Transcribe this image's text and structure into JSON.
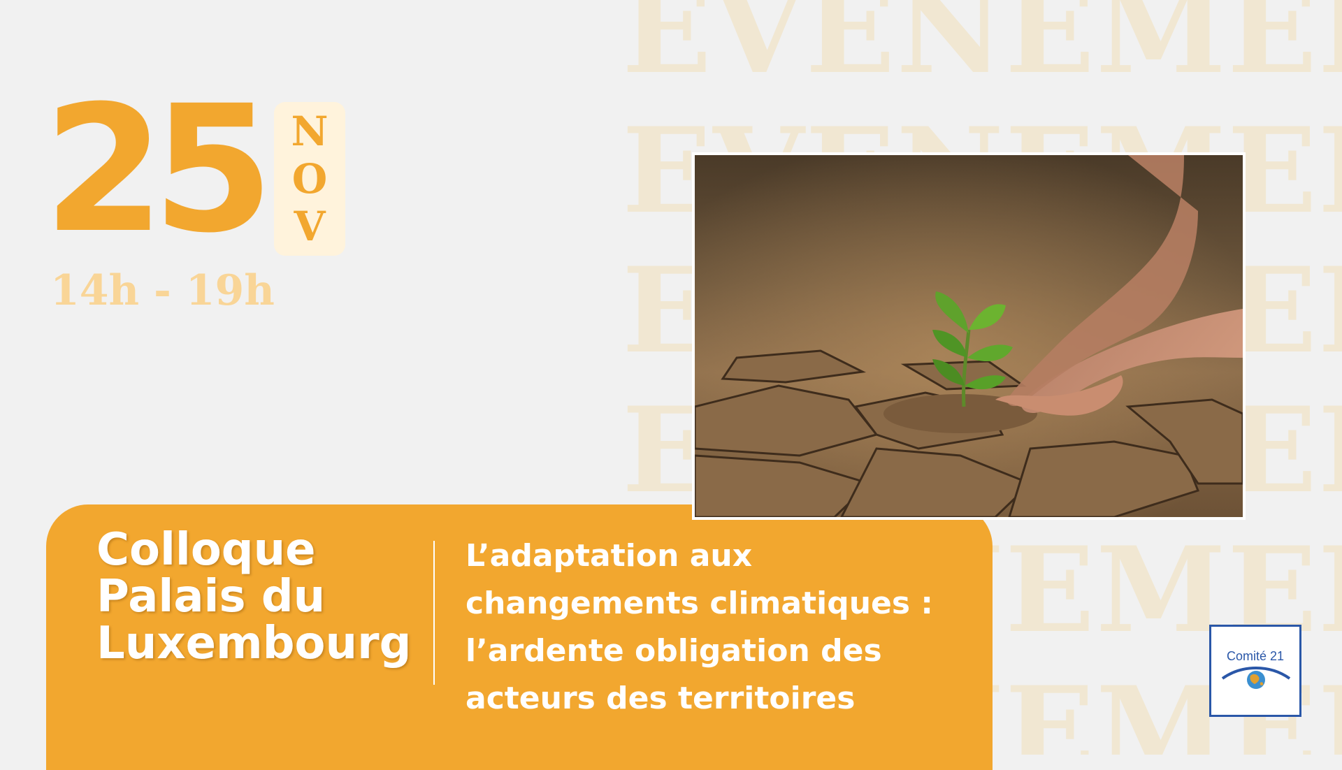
{
  "watermark": {
    "word": "EVENEMENT"
  },
  "date": {
    "day": "25",
    "month_letters": [
      "N",
      "O",
      "V"
    ],
    "time": "14h - 19h"
  },
  "banner": {
    "venue_lines": [
      "Colloque",
      "Palais du",
      "Luxembourg"
    ],
    "topic_lines": [
      "L’adaptation aux",
      "changements climatiques :",
      "l’ardente obligation des",
      "acteurs des territoires"
    ]
  },
  "logo": {
    "text": "Comité 21"
  },
  "colors": {
    "accent": "#f2a72f",
    "accent_light": "#fff3dc",
    "time_color": "#f9d597",
    "watermark": "#f1e7d2",
    "background": "#f1f1f1",
    "logo_blue": "#2a57a8"
  },
  "photo": {
    "subject": "hands-planting-seedling-in-cracked-soil-image"
  }
}
